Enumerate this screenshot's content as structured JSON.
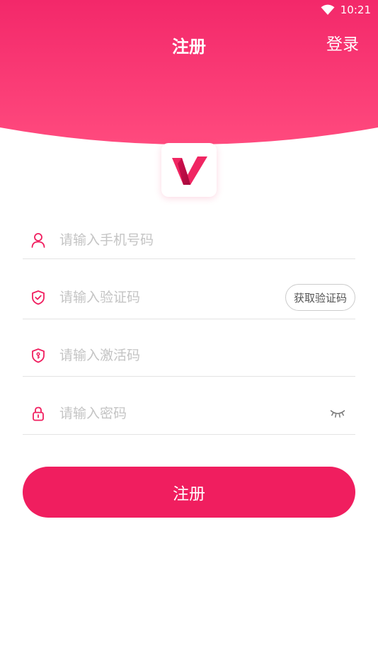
{
  "status_bar": {
    "time": "10:21"
  },
  "nav": {
    "title": "注册",
    "login_label": "登录"
  },
  "colors": {
    "accent": "#f01e5f",
    "header_top": "#f3286a",
    "header_bottom": "#ff4a7e"
  },
  "form": {
    "phone": {
      "placeholder": "请输入手机号码",
      "icon": "user-icon"
    },
    "code": {
      "placeholder": "请输入验证码",
      "icon": "shield-check-icon",
      "button_label": "获取验证码"
    },
    "activation": {
      "placeholder": "请输入激活码",
      "icon": "shield-key-icon"
    },
    "password": {
      "placeholder": "请输入密码",
      "icon": "lock-icon",
      "toggle_icon": "eye-closed-icon"
    }
  },
  "submit_label": "注册"
}
